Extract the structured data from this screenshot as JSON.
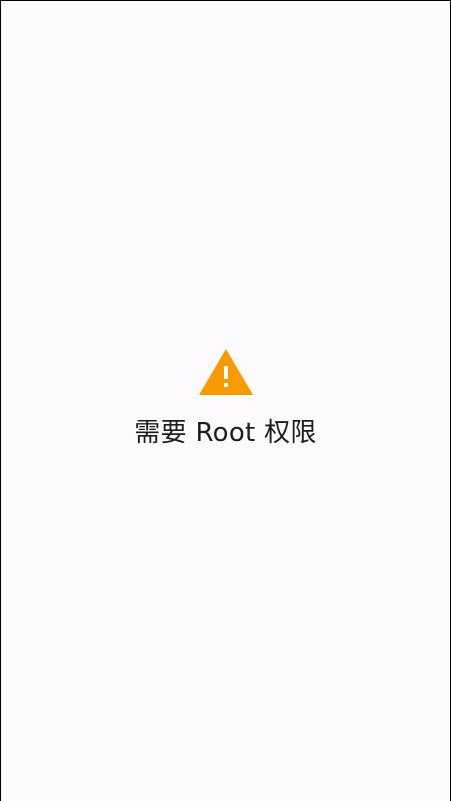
{
  "colors": {
    "background": "#fdfafd",
    "warning": "#f79a00",
    "text": "#1d1b1f"
  },
  "icon": {
    "name": "warning-icon"
  },
  "message": {
    "text": "需要 Root 权限"
  }
}
